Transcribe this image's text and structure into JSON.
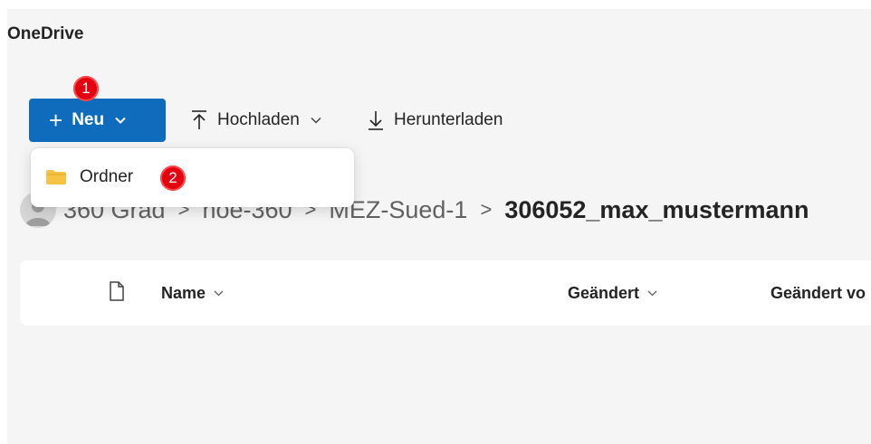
{
  "app": {
    "title": "OneDrive"
  },
  "toolbar": {
    "new_label": "Neu",
    "upload_label": "Hochladen",
    "download_label": "Herunterladen"
  },
  "new_menu": {
    "items": [
      {
        "label": "Ordner",
        "icon": "folder-icon"
      }
    ]
  },
  "markers": {
    "first": "1",
    "second": "2"
  },
  "breadcrumb": {
    "items": [
      "360 Grad",
      "noe-360",
      "MEZ-Sued-1"
    ],
    "current": "306052_max_mustermann",
    "separator": ">"
  },
  "file_list": {
    "columns": {
      "name": "Name",
      "modified": "Geändert",
      "modified_by": "Geändert vo"
    }
  },
  "colors": {
    "accent": "#0f6cbd",
    "marker": "#e3000f",
    "folder": "#f6c445"
  }
}
